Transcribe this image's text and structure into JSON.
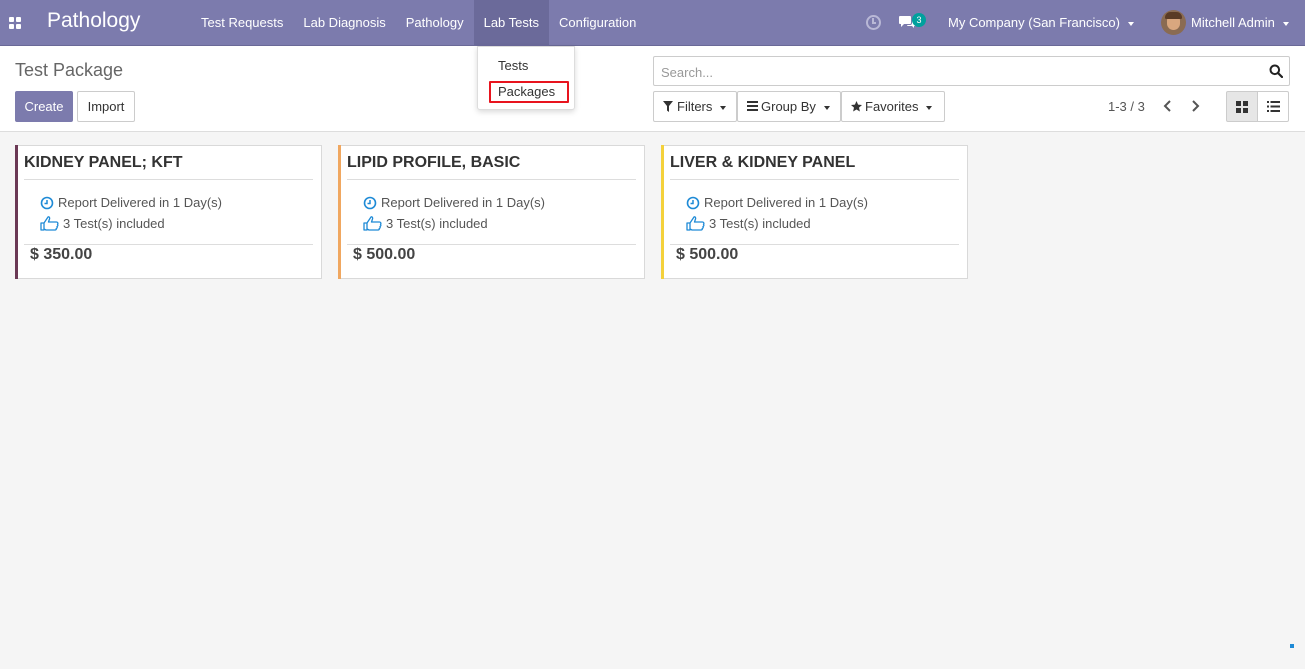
{
  "navbar": {
    "app_name": "Pathology",
    "menu": [
      {
        "label": "Test Requests"
      },
      {
        "label": "Lab Diagnosis"
      },
      {
        "label": "Pathology"
      },
      {
        "label": "Lab Tests",
        "active": true
      },
      {
        "label": "Configuration"
      }
    ],
    "chat_badge": "3",
    "company": "My Company (San Francisco)",
    "user": "Mitchell Admin"
  },
  "dropdown": {
    "items": [
      {
        "label": "Tests"
      },
      {
        "label": "Packages",
        "highlighted": true
      }
    ]
  },
  "control_panel": {
    "title": "Test Package",
    "create_label": "Create",
    "import_label": "Import",
    "search_placeholder": "Search...",
    "filters_label": "Filters",
    "groupby_label": "Group By",
    "favorites_label": "Favorites",
    "pager": "1-3 / 3"
  },
  "cards": [
    {
      "name": "KIDNEY PANEL; KFT",
      "delivery": "Report Delivered in 1 Day(s)",
      "tests": "3 Test(s) included",
      "price": "$ 350.00",
      "color": "#6b3955"
    },
    {
      "name": "LIPID PROFILE, BASIC",
      "delivery": "Report Delivered in 1 Day(s)",
      "tests": "3 Test(s) included",
      "price": "$ 500.00",
      "color": "#f0a760"
    },
    {
      "name": "LIVER & KIDNEY PANEL",
      "delivery": "Report Delivered in 1 Day(s)",
      "tests": "3 Test(s) included",
      "price": "$ 500.00",
      "color": "#f4d13b"
    }
  ],
  "colors": {
    "brand": "#7c7bad",
    "highlight": "#e8141e",
    "icon_blue": "#1e8ad6"
  }
}
